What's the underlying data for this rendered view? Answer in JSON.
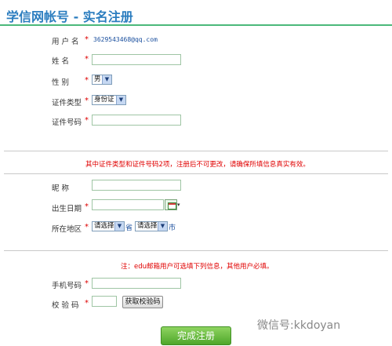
{
  "header": {
    "title": "学信网帐号 - 实名注册"
  },
  "form1": {
    "username_label": "用 户 名",
    "username_value": "3629543468@qq.com",
    "name_label": "姓    名",
    "gender_label": "性    别",
    "gender_value": "男",
    "idtype_label": "证件类型",
    "idtype_value": "身份证",
    "idnum_label": "证件号码"
  },
  "notice1": "其中证件类型和证件号码2项，注册后不可更改，请确保所填信息真实有效。",
  "form2": {
    "nickname_label": "昵    称",
    "birth_label": "出生日期",
    "region_label": "所在地区",
    "province_value": "请选择",
    "province_suffix": "省",
    "city_value": "请选择",
    "city_suffix": "市"
  },
  "notice2": "注：edu邮箱用户可选填下列信息，其他用户必填。",
  "form3": {
    "phone_label": "手机号码",
    "captcha_label": "校 验 码",
    "get_code_label": "获取校验码"
  },
  "required_mark": "*",
  "submit_label": "完成注册",
  "watermark": "微信号:kkdoyan"
}
